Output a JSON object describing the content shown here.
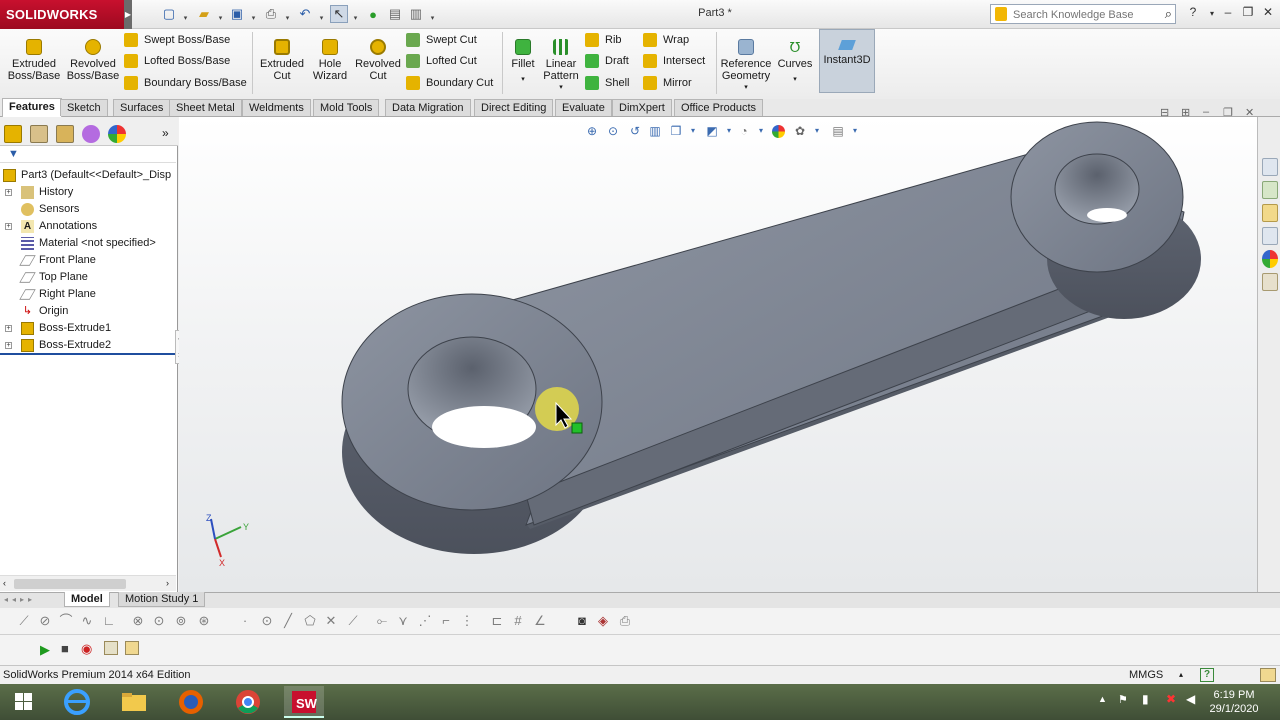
{
  "app": {
    "logo_text": "SOLIDWORKS",
    "doc_title": "Part3 *",
    "search_placeholder": "Search Knowledge Base",
    "accent": "#c8102e"
  },
  "ribbon": {
    "extruded_boss": "Extruded Boss/Base",
    "revolved_boss": "Revolved Boss/Base",
    "swept_boss": "Swept Boss/Base",
    "lofted_boss": "Lofted Boss/Base",
    "boundary_boss": "Boundary Boss/Base",
    "extruded_cut": "Extruded Cut",
    "hole_wizard": "Hole Wizard",
    "revolved_cut": "Revolved Cut",
    "swept_cut": "Swept Cut",
    "lofted_cut": "Lofted Cut",
    "boundary_cut": "Boundary Cut",
    "fillet": "Fillet",
    "linear_pattern": "Linear Pattern",
    "rib": "Rib",
    "draft": "Draft",
    "shell": "Shell",
    "wrap": "Wrap",
    "intersect": "Intersect",
    "mirror": "Mirror",
    "reference_geometry": "Reference Geometry",
    "curves": "Curves",
    "instant3d": "Instant3D"
  },
  "tabs": [
    "Features",
    "Sketch",
    "Surfaces",
    "Sheet Metal",
    "Weldments",
    "Mold Tools",
    "Data Migration",
    "Direct Editing",
    "Evaluate",
    "DimXpert",
    "Office Products"
  ],
  "tree": {
    "root": "Part3  (Default<<Default>_Disp",
    "items": [
      "History",
      "Sensors",
      "Annotations",
      "Material <not specified>",
      "Front Plane",
      "Top Plane",
      "Right Plane",
      "Origin",
      "Boss-Extrude1",
      "Boss-Extrude2"
    ]
  },
  "triad": {
    "x": "X",
    "y": "Y",
    "z": "Z"
  },
  "bottom_tabs": [
    "Model",
    "Motion Study 1"
  ],
  "status": {
    "edition": "SolidWorks Premium 2014 x64 Edition",
    "units": "MMGS"
  },
  "clock": {
    "time": "6:19 PM",
    "date": "29/1/2020"
  }
}
